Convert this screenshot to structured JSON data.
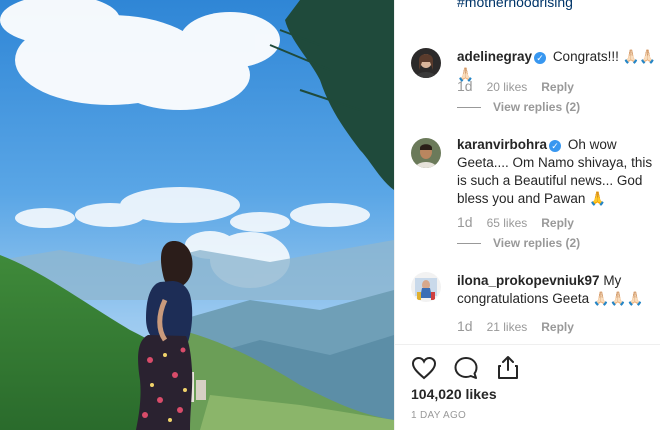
{
  "caption": {
    "hashtag": "#motherhoodrising"
  },
  "comments": [
    {
      "username": "adelinegray",
      "verified": true,
      "text": "Congrats!!! 🙏🏻🙏🏻🙏🏻",
      "age": "1d",
      "likes": "20 likes",
      "reply_label": "Reply",
      "view_replies": "View replies (2)"
    },
    {
      "username": "karanvirbohra",
      "verified": true,
      "text": "Oh wow Geeta.... Om Namo shivaya, this is such a Beautiful news... God bless you and Pawan 🙏",
      "age": "1d",
      "likes": "65 likes",
      "reply_label": "Reply",
      "view_replies": "View replies (2)"
    },
    {
      "username": "ilona_prokopevniuk97",
      "verified": false,
      "text": "My congratulations Geeta 🙏🏻🙏🏻🙏🏻",
      "age": "1d",
      "likes": "21 likes",
      "reply_label": "Reply"
    }
  ],
  "post": {
    "like_count": "104,020 likes",
    "time_ago": "1 DAY AGO"
  },
  "icons": [
    "heart-icon",
    "comment-icon",
    "share-icon",
    "verified-icon"
  ],
  "colors": {
    "link": "#003569",
    "verified": "#3897f0",
    "muted": "#999999",
    "text": "#262626"
  }
}
